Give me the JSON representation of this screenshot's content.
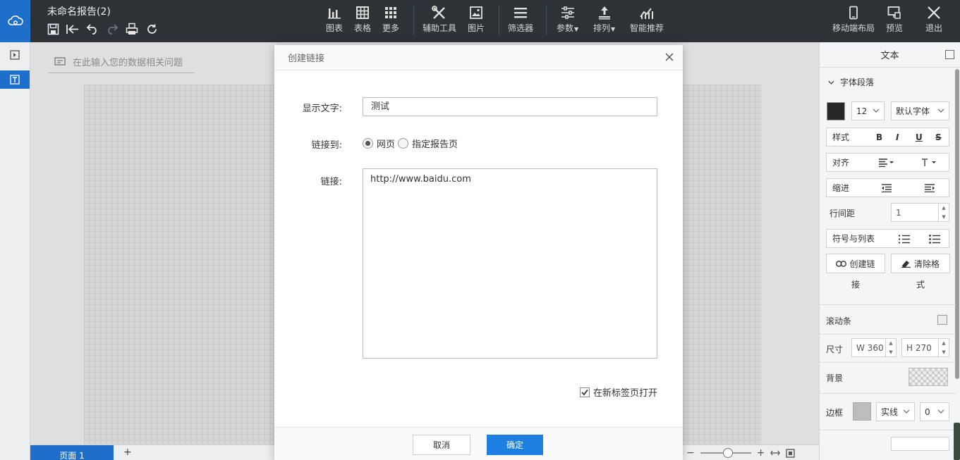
{
  "app": {
    "doc_title": "未命名报告(2)"
  },
  "toolbar": {
    "tools": [
      {
        "name": "chart",
        "label": "图表"
      },
      {
        "name": "table",
        "label": "表格"
      },
      {
        "name": "more",
        "label": "更多"
      },
      {
        "name": "aux",
        "label": "辅助工具"
      },
      {
        "name": "image",
        "label": "图片"
      },
      {
        "name": "filter",
        "label": "筛选器"
      },
      {
        "name": "params",
        "label": "参数"
      },
      {
        "name": "arrange",
        "label": "排列"
      },
      {
        "name": "smart",
        "label": "智能推荐"
      },
      {
        "name": "mobile",
        "label": "移动端布局"
      },
      {
        "name": "preview",
        "label": "预览"
      },
      {
        "name": "exit",
        "label": "退出"
      }
    ]
  },
  "workspace": {
    "ask_placeholder": "在此输入您的数据相关问题"
  },
  "bottombar": {
    "page_tab": "页面 1",
    "add_page": "+",
    "zoom_minus": "−",
    "zoom_plus": "+"
  },
  "dialog": {
    "title": "创建链接",
    "display_text_label": "显示文字:",
    "display_text_value": "测试",
    "link_to_label": "链接到:",
    "radio_webpage": "网页",
    "radio_report_page": "指定报告页",
    "selected_link_type": "网页",
    "link_label": "链接:",
    "link_value": "http://www.baidu.com",
    "new_tab_label": "在新标签页打开",
    "new_tab_checked": true,
    "cancel": "取消",
    "ok": "确定"
  },
  "rpanel": {
    "title": "文本",
    "section": "字体段落",
    "font_color": "#262626",
    "font_size": "12",
    "font_family": "默认字体",
    "style_label": "样式",
    "bold": "B",
    "italic": "I",
    "underline": "U",
    "strike": "S",
    "align_label": "对齐",
    "indent_label": "缩进",
    "line_spacing_label": "行间距",
    "line_spacing_value": "1",
    "list_label": "符号与列表",
    "create_link_line1": "创建链",
    "create_link_line2": "接",
    "clear_format_line1": "清除格",
    "clear_format_line2": "式",
    "scrollbar_label": "滚动条",
    "size_label": "尺寸",
    "width_value": "W 360",
    "height_value": "H 270",
    "background_label": "背景",
    "border_label": "边框",
    "border_style": "实线",
    "border_width": "0"
  },
  "colors": {
    "accent": "#1d6fc9",
    "topbar": "#2c3236",
    "primary_button": "#1d7fe0"
  }
}
